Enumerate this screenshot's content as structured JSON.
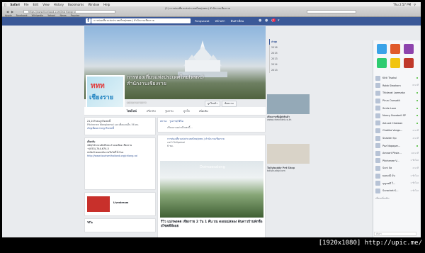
{
  "os_menubar": {
    "app": "Safari",
    "items": [
      "File",
      "Edit",
      "View",
      "History",
      "Bookmarks",
      "Window",
      "Help"
    ],
    "clock": "Thu 2:57 PM"
  },
  "browser": {
    "window_title": "(2) การท่องเที่ยวแห่งประเทศไทย(ททท.) สำนักงานเชียงราย",
    "url": "https://www.facebook.com/tatchiangrai",
    "bookmarks": [
      "Apple",
      "Facebook",
      "Wikipedia",
      "Yahoo!",
      "News",
      "Popular"
    ]
  },
  "facebook_bar": {
    "logo": "f",
    "search_value": "การท่องเที่ยวแห่งประเทศไทย(ททท.) สำนักงานเชียงราย",
    "user": "Pongsawat",
    "home": "หน้าแรก",
    "find_friends": "ค้นหาเพื่อน",
    "notif_count": "2"
  },
  "page": {
    "title": "การท่องเที่ยวแห่งประเทศไทย(ททท.) สำนักงานเชียงราย",
    "category": "หน่วยงานราชการ",
    "logo_word1": "ททท",
    "logo_word2": "เชียงราย",
    "like_btn": "ถูกใจแล้ว",
    "message_btn": "ข้อความ",
    "tabs": [
      "ไทม์ไลน์",
      "เกี่ยวกับ",
      "รูปภาพ",
      "ถูกใจ",
      "เพิ่มเติม"
    ]
  },
  "left": {
    "likes": "21,109 คนถูกใจเพจนี้",
    "likes_sub": "Pitchenee Wangkamol และเพื่อนคนอื่น 56 คน",
    "invite": "เชิญเพื่อนมากดถูกใจเพจนี้",
    "about_header": "เกี่ยวกับ",
    "address": "448/16 ถนนสิงห์ไคล อำเภอเมือง เชียงราย",
    "phone": "+(053)-744-674-5",
    "hours": "ปกติแล้วตอบกลับภายในไม่กี่ชั่วโมง",
    "website": "http://www.tourismthailand.org/chiang-rai",
    "apps": "Livestream",
    "videos_header": "วิดีโอ"
  },
  "mid": {
    "post_status": "สถานะ",
    "post_photo": "รูปภาพ/วิดีโอ",
    "post_placeholder": "เขียนบางอย่างถึงเพจนี้...",
    "post_author": "การท่องเที่ยวแห่งประเทศไทย(ททท.) สำนักงานเชียงราย",
    "post_shared_from": "แชร์ Chillpainai",
    "post_time": "6 ชม.",
    "feed_title": "รีวิว แม่กพงคต เชียงราย 2 วัน 1 คืน บน ดอยแม่สลอง ดินดาวบ้านพักชื่อยไซตดีส์ลอย",
    "feed_watermark": "Doimaesalong"
  },
  "right": {
    "years_label": "ล่าสุด",
    "years": [
      "2016",
      "2015",
      "2013",
      "2014",
      "2013"
    ],
    "ad1_title": "เขียนรายชื่อผู้ส่งสินค้า",
    "ad1_sub": "www.chevrolet.co.th",
    "ad2_title": "Tollybuddy Pet Shop",
    "ad2_sub": "tollybuddy.com"
  },
  "chat": {
    "contacts": [
      {
        "name": "Kitti Tisakul",
        "time": ""
      },
      {
        "name": "Robb Siwakorn",
        "time": "6 นาที"
      },
      {
        "name": "Thidarat Laemaka",
        "time": ""
      },
      {
        "name": "Pirun Ounsatit",
        "time": ""
      },
      {
        "name": "Smile Love",
        "time": ""
      },
      {
        "name": "Nancy Nuvabell SP",
        "time": ""
      },
      {
        "name": "Ast-ast Chaiwan",
        "time": ""
      },
      {
        "name": "Chotika Vongs...",
        "time": "2 นาที"
      },
      {
        "name": "Snacker hp",
        "time": "4 นาที"
      },
      {
        "name": "Poz Napapar...",
        "time": ""
      },
      {
        "name": "Amnart Pitsle...",
        "time": "16 นาที"
      },
      {
        "name": "Pitchenee V...",
        "time": "1 ชั่วโมง"
      },
      {
        "name": "Suni Sa",
        "time": "2 นาที"
      },
      {
        "name": "ยอดมณี มั่น",
        "time": "1 ชั่วโมง"
      },
      {
        "name": "บุญชลธี ใ...",
        "time": "1 ชั่วโมง"
      },
      {
        "name": "Surachet K...",
        "time": "1 ชั่วโมง"
      }
    ],
    "more": "เพื่อนเพิ่มเติม",
    "search": "ค้นหา"
  },
  "watermark": "[1920x1080] http://upic.me/"
}
